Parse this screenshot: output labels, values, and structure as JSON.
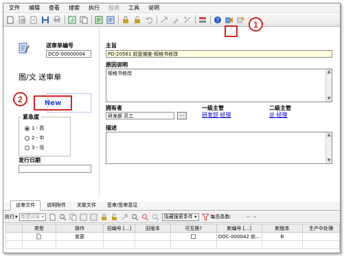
{
  "menu": [
    "文件",
    "编辑",
    "查看",
    "搜索",
    "执行",
    "报表",
    "工具",
    "说明"
  ],
  "menu_disabled_index": 5,
  "callouts": {
    "first": "1",
    "second": "2"
  },
  "header": {
    "doc_number_label": "送审单编号",
    "doc_number_value": "DCO-00000004",
    "subject_label": "主旨",
    "subject_value": "PD-20561 前篮坡座-规格书修改",
    "form_title": "图/文 送审单",
    "state_button": "New"
  },
  "reason": {
    "label": "原因说明",
    "value": "规格书修改"
  },
  "owner": {
    "label": "拥有者",
    "value": "研发部 员工",
    "picker": "..."
  },
  "approvers": [
    {
      "label": "一级主管",
      "value": "研发部 经理"
    },
    {
      "label": "二级主管",
      "value": "总 经理"
    }
  ],
  "urgency": {
    "label": "紧急度",
    "options": [
      "1 - 高",
      "2 - 中",
      "3 - 低"
    ],
    "selected": 0
  },
  "description": {
    "label": "描述",
    "value": ""
  },
  "release_date": {
    "label": "发行日期",
    "value": ""
  },
  "tabs": [
    "送审文件",
    "说明附件",
    "关联文件",
    "签审/签审意见"
  ],
  "active_tab": 0,
  "bottom_toolbar": {
    "run_label": "执行",
    "new_item_select": "新建对象",
    "hide_search_select": "隐藏搜索条件",
    "per_page_label": "每页条数:"
  },
  "grid": {
    "columns": [
      "类型",
      "操作",
      "旧编号 [...]",
      "旧版本",
      "可互换?",
      "新编号 [...]",
      "新版本",
      "生产中处理"
    ],
    "rows": [
      {
        "type_icon": "document-icon",
        "action": "变更",
        "old_number": "",
        "old_version": "",
        "interchangeable": false,
        "new_number": "DOC-000042 前...",
        "new_version": "B",
        "in_production": ""
      }
    ]
  },
  "colors": {
    "callout": "#cc1e1e",
    "subject_bg": "#ffffdd",
    "link": "#0000cc"
  }
}
